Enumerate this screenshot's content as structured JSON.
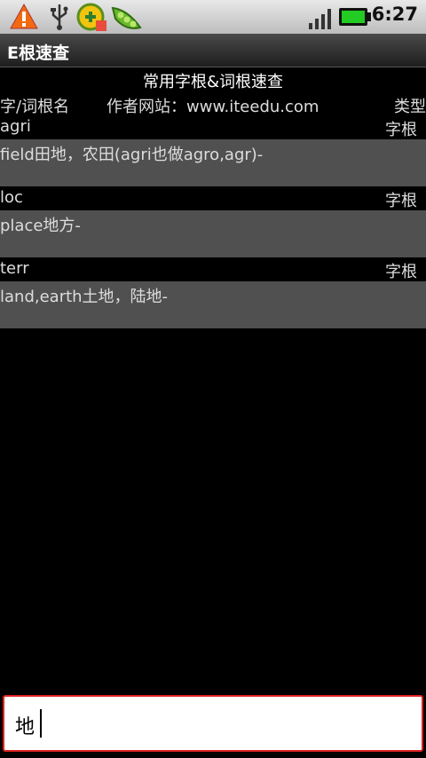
{
  "status_bar": {
    "time": "6:27",
    "icons": [
      "warning-icon",
      "usb-icon",
      "app-badge-icon",
      "peapod-icon",
      "signal-icon",
      "battery-icon"
    ]
  },
  "app": {
    "title": "E根速查"
  },
  "heading": "常用字根&词根速查",
  "header": {
    "col_name": "字/词根名",
    "col_site": "作者网站：www.iteedu.com",
    "col_type": "类型"
  },
  "entries": [
    {
      "name": "agri",
      "type": "字根",
      "meaning": "field田地，农田(agri也做agro,agr)-"
    },
    {
      "name": "loc",
      "type": "字根",
      "meaning": "place地方-"
    },
    {
      "name": "terr",
      "type": "字根",
      "meaning": "land,earth土地，陆地-"
    }
  ],
  "search": {
    "value": "地"
  },
  "colors": {
    "input_border": "#dd2222",
    "row_bg": "#505050",
    "battery": "#22cc22"
  }
}
